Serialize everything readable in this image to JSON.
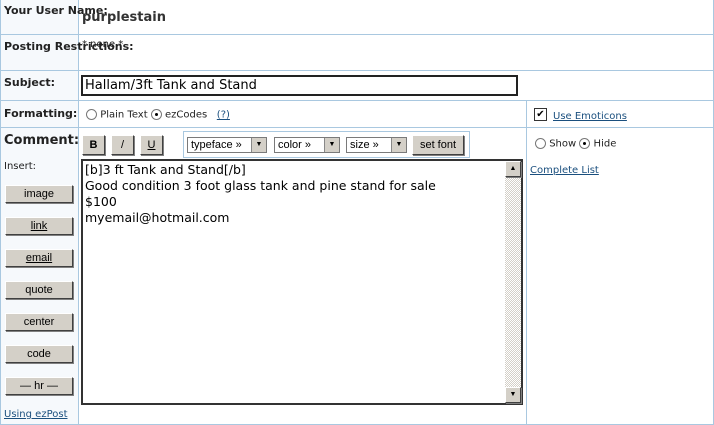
{
  "labels": {
    "username": "Your User Name:",
    "restrictions": "Posting Restrictions:",
    "subject": "Subject:",
    "formatting": "Formatting:",
    "comment": "Comment:",
    "insert": "Insert:"
  },
  "username": "purplestain",
  "restrictions": "* none *",
  "subject_value": "Hallam/3ft Tank and Stand",
  "formatting": {
    "plain": "Plain Text",
    "ezcodes": "ezCodes",
    "help": "(?)",
    "selected": "ezCodes"
  },
  "emoticons": {
    "label": "Use Emoticons",
    "checked": true,
    "show": "Show",
    "hide": "Hide",
    "selected": "Hide",
    "complete_list": "Complete List"
  },
  "toolbar": {
    "bold": "B",
    "italic": "/",
    "underline": "U",
    "typeface": "typeface »",
    "color": "color »",
    "size": "size »",
    "set_font": "set font"
  },
  "insert_buttons": [
    "image",
    "link",
    "email",
    "quote",
    "center",
    "code",
    "— hr —"
  ],
  "comment_text": "[b]3 ft Tank and Stand[/b]\nGood condition 3 foot glass tank and pine stand for sale\n$100\nmyemail@hotmail.com",
  "using_ezpost": "Using ezPost"
}
